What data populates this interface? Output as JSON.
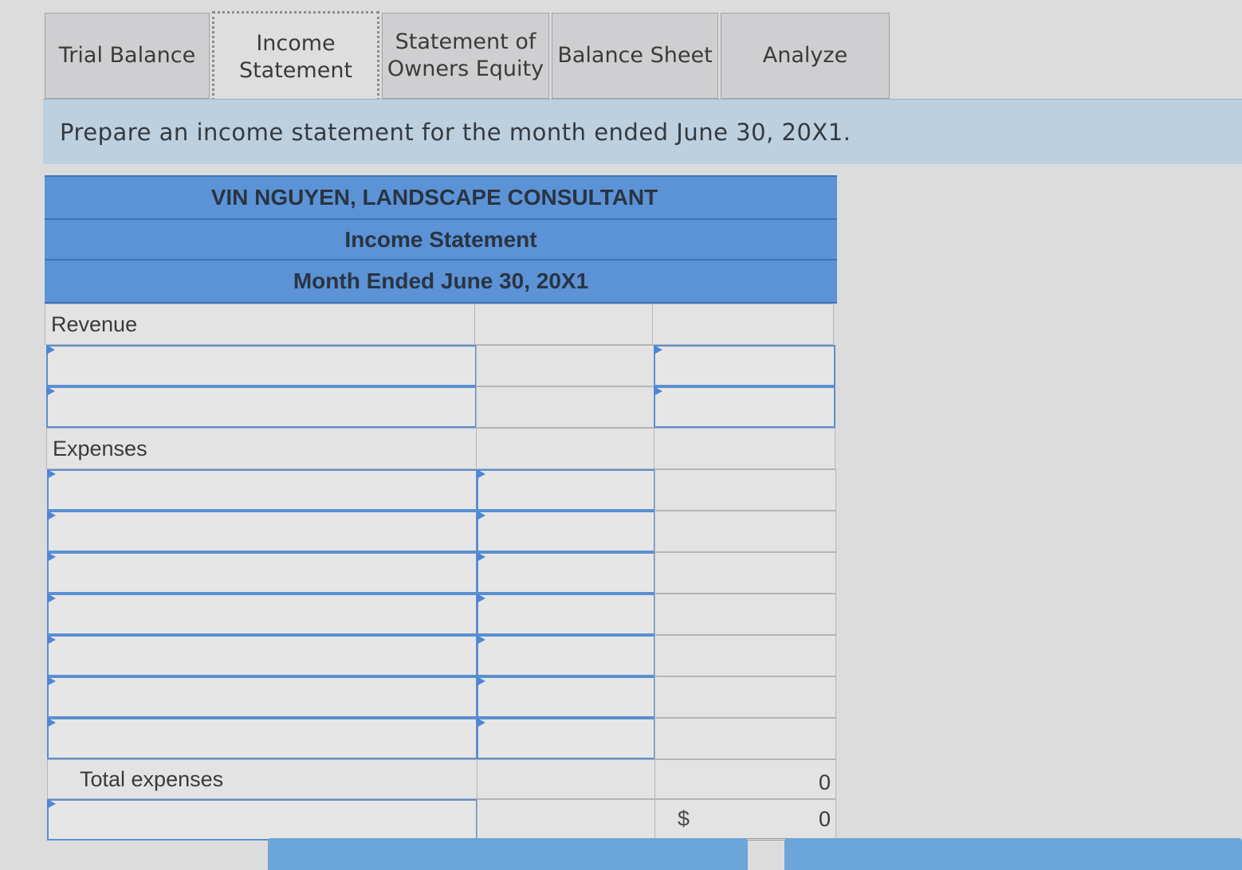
{
  "tabs": [
    {
      "label": "Trial Balance",
      "active": false
    },
    {
      "label": "Income\nStatement",
      "active": true
    },
    {
      "label": "Statement of\nOwners Equity",
      "active": false
    },
    {
      "label": "Balance Sheet",
      "active": false
    },
    {
      "label": "Analyze",
      "active": false
    }
  ],
  "instruction": "Prepare an income statement for the month ended June 30, 20X1.",
  "statement": {
    "company": "VIN NGUYEN,  LANDSCAPE CONSULTANT",
    "title": "Income Statement",
    "period": "Month Ended June 30, 20X1",
    "revenue_label": "Revenue",
    "expenses_label": "Expenses",
    "total_expenses_label": "Total expenses",
    "total_expenses_value": "0",
    "net_currency": "$",
    "net_value": "0"
  },
  "colors": {
    "header_blue": "#5b93d6",
    "input_border": "#5b8fd1",
    "instruction_bg": "#bcd0e0",
    "background": "#dcdcdc"
  },
  "icons": {
    "input_marker": "triangle-right-icon"
  }
}
